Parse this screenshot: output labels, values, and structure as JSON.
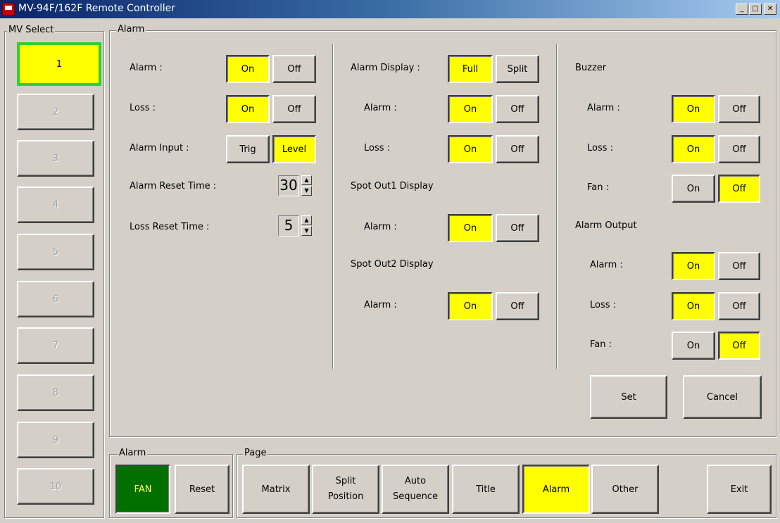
{
  "window": {
    "title": "MV-94F/162F Remote Controller",
    "minimize": "_",
    "maximize": "□",
    "close": "✕"
  },
  "mv_select": {
    "legend": "MV Select",
    "items": [
      "1",
      "2",
      "3",
      "4",
      "5",
      "6",
      "7",
      "8",
      "9",
      "10"
    ],
    "selected": "1"
  },
  "alarm_group": {
    "legend": "Alarm",
    "alarm_label": "Alarm :",
    "on": "On",
    "off": "Off",
    "loss_label": "Loss :",
    "alarm_input_label": "Alarm Input :",
    "trig": "Trig",
    "level": "Level",
    "alarm_reset_label": "Alarm Reset Time :",
    "alarm_reset_value": "30",
    "loss_reset_label": "Loss Reset Time :",
    "loss_reset_value": "5",
    "alarm_display_label": "Alarm Display :",
    "full": "Full",
    "split": "Split",
    "display_alarm_label": "Alarm :",
    "display_loss_label": "Loss :",
    "spot1_label": "Spot Out1 Display",
    "spot1_alarm_label": "Alarm :",
    "spot2_label": "Spot Out2 Display",
    "spot2_alarm_label": "Alarm :",
    "buzzer_label": "Buzzer",
    "buzzer_alarm_label": "Alarm :",
    "buzzer_loss_label": "Loss :",
    "buzzer_fan_label": "Fan :",
    "output_label": "Alarm Output",
    "output_alarm_label": "Alarm :",
    "output_loss_label": "Loss :",
    "output_fan_label": "Fan :",
    "set": "Set",
    "cancel": "Cancel"
  },
  "bottom_alarm": {
    "legend": "Alarm",
    "fan": "FAN",
    "reset": "Reset"
  },
  "page": {
    "legend": "Page",
    "matrix": "Matrix",
    "split_position": [
      "Split",
      "Position"
    ],
    "auto_sequence": [
      "Auto",
      "Sequence"
    ],
    "title": "Title",
    "alarm": "Alarm",
    "other": "Other",
    "exit": "Exit"
  },
  "colors": {
    "selected": "#ffff00",
    "mv_border": "#33cc33",
    "fan_active": "#007000",
    "face": "#d4d0c8"
  }
}
